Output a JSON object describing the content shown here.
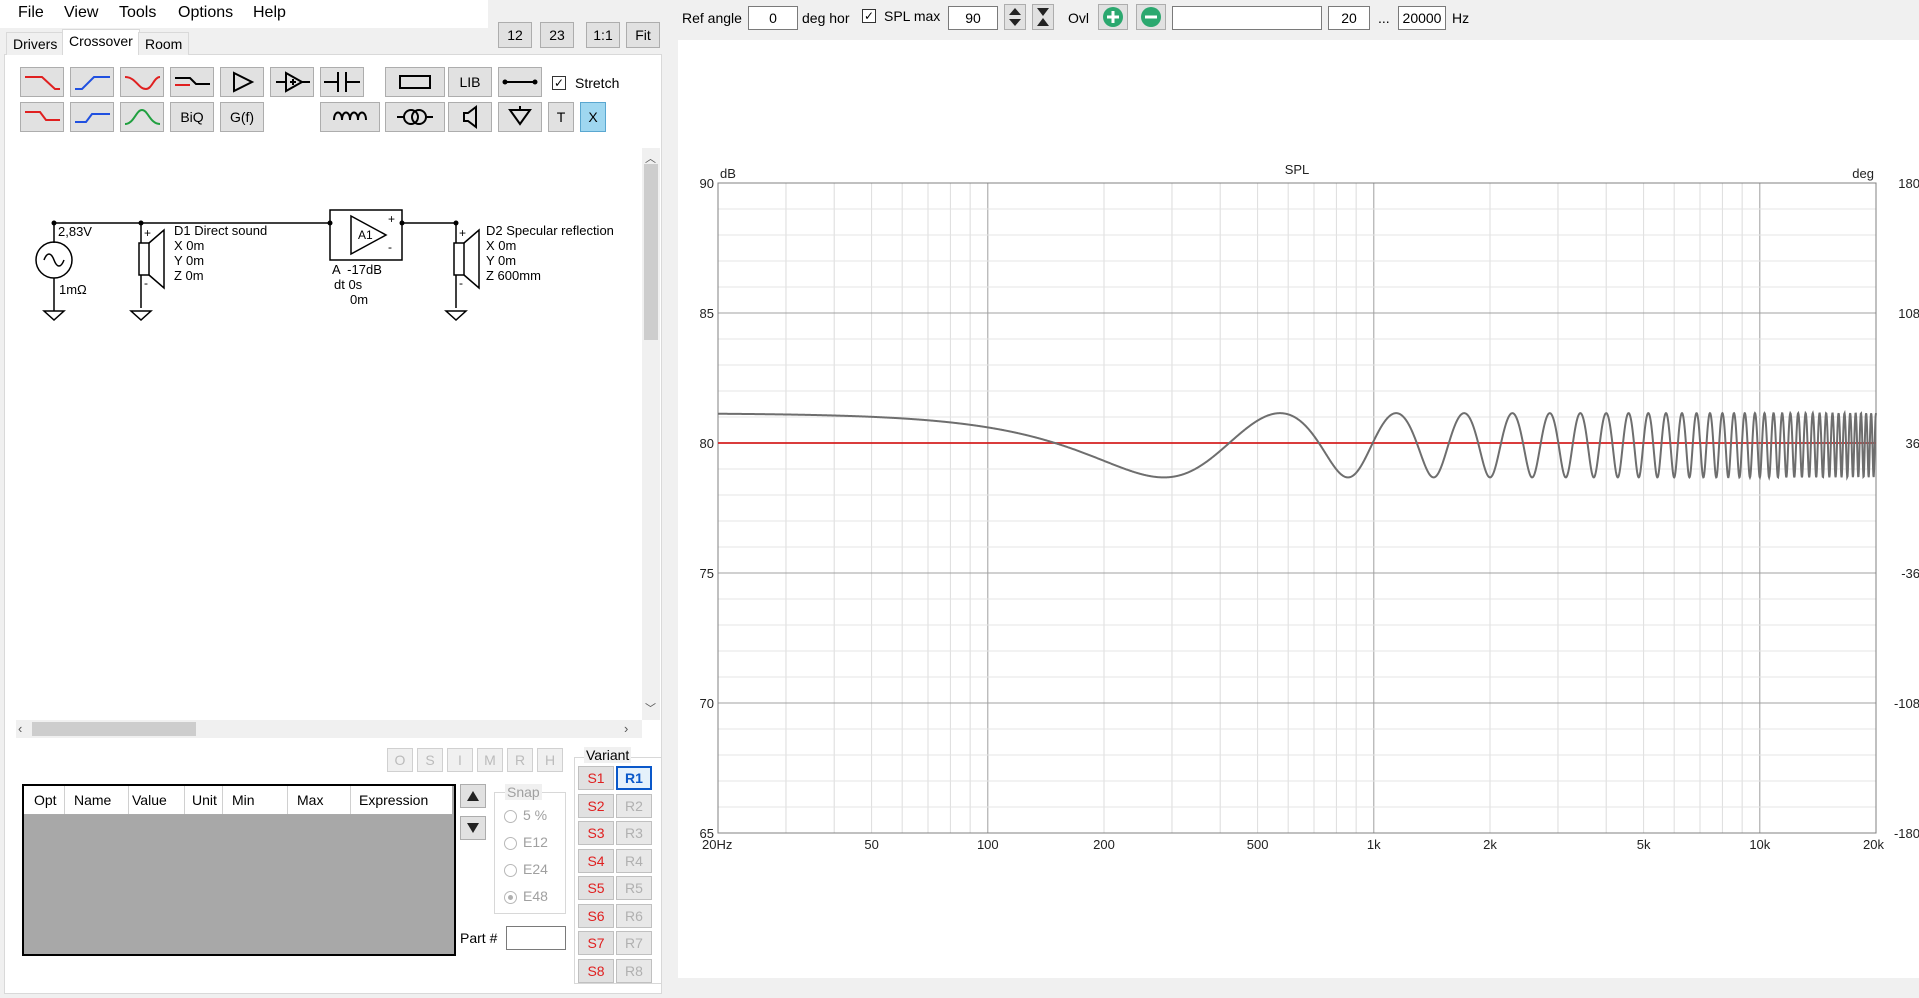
{
  "menu": [
    "File",
    "View",
    "Tools",
    "Options",
    "Help"
  ],
  "zoom_buttons": [
    "12",
    "23",
    "1:1",
    "Fit"
  ],
  "tabs": [
    "Drivers",
    "Crossover",
    "Room"
  ],
  "toolbar": {
    "lib_label": "LIB",
    "biq_label": "BiQ",
    "gf_label": "G(f)",
    "t_label": "T",
    "x_label": "X",
    "stretch_label": "Stretch",
    "stretch_checked": true
  },
  "schematic": {
    "source_voltage": "2,83V",
    "source_impedance": "1mΩ",
    "d1": {
      "name": "D1 Direct sound",
      "x": "X 0m",
      "y": "Y 0m",
      "z": "Z 0m"
    },
    "amp": {
      "name": "A1",
      "gain": "A  -17dB",
      "dt": "dt 0s",
      "dist": "0m",
      "plus": "+",
      "minus": "-"
    },
    "d2": {
      "name": "D2 Specular reflection",
      "x": "X 0m",
      "y": "Y 0m",
      "z": "Z 600mm"
    },
    "driver_plus": "+",
    "driver_minus": "-"
  },
  "osimrh": [
    "O",
    "S",
    "I",
    "M",
    "R",
    "H"
  ],
  "param_table": {
    "columns": [
      "Opt",
      "Name",
      "Value",
      "Unit",
      "Min",
      "Max",
      "Expression"
    ]
  },
  "snap": {
    "title": "Snap",
    "options": [
      "5 %",
      "E12",
      "E24",
      "E48"
    ],
    "selected": "E48"
  },
  "part_label": "Part #",
  "part_value": "",
  "variant": {
    "title": "Variant",
    "s": [
      "S1",
      "S2",
      "S3",
      "S4",
      "S5",
      "S6",
      "S7",
      "S8"
    ],
    "r": [
      "R1",
      "R2",
      "R3",
      "R4",
      "R5",
      "R6",
      "R7",
      "R8"
    ],
    "active_r": "R1"
  },
  "topbar": {
    "ref_angle_label": "Ref angle",
    "ref_angle_value": "0",
    "deg_hor_label": "deg hor",
    "spl_max_label": "SPL max",
    "spl_max_checked": true,
    "spl_max_value": "90",
    "ovl_label": "Ovl",
    "ovl_name_value": "",
    "f_min": "20",
    "ellipsis": "...",
    "f_max": "20000",
    "hz_label": "Hz"
  },
  "chart_data": {
    "type": "line",
    "title": "SPL",
    "ylabel": "dB",
    "y2label": "deg",
    "xscale": "log",
    "xlim": [
      20,
      20000
    ],
    "ylim": [
      65,
      90
    ],
    "y2lim": [
      -180,
      180
    ],
    "x_ticks": [
      {
        "v": 20,
        "label": "20Hz"
      },
      {
        "v": 50,
        "label": "50"
      },
      {
        "v": 100,
        "label": "100"
      },
      {
        "v": 200,
        "label": "200"
      },
      {
        "v": 500,
        "label": "500"
      },
      {
        "v": 1000,
        "label": "1k"
      },
      {
        "v": 2000,
        "label": "2k"
      },
      {
        "v": 5000,
        "label": "5k"
      },
      {
        "v": 10000,
        "label": "10k"
      },
      {
        "v": 20000,
        "label": "20k"
      }
    ],
    "y_ticks": [
      90,
      85,
      80,
      75,
      70,
      65
    ],
    "y2_ticks": [
      180,
      108,
      36,
      -36,
      -108,
      -180
    ],
    "grid": true,
    "series": [
      {
        "color": "#d42020",
        "y_const": 80.0
      },
      {
        "color": "#6e6e6e",
        "model": {
          "base_db": 80,
          "direct_gain": 1.0,
          "reflection_gain": 0.1413,
          "reflection_delay_ms": 1.75,
          "lowfreq_level_db": 81.0
        }
      }
    ],
    "colors": {
      "red_series": "#d42020",
      "gray_series": "#6e6e6e"
    }
  }
}
